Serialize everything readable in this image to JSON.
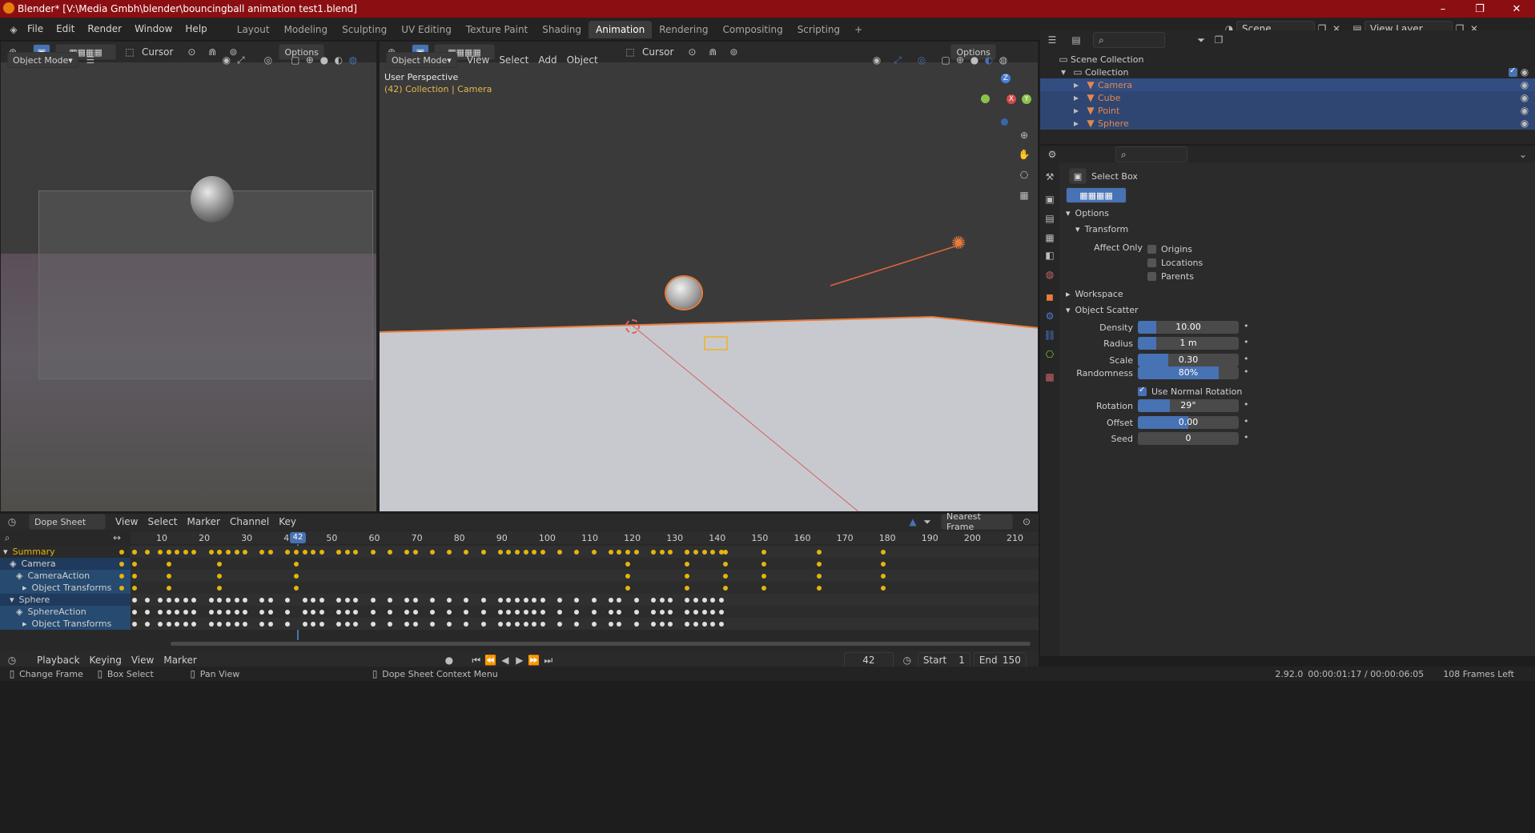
{
  "window": {
    "title": "Blender* [V:\\Media Gmbh\\blender\\bouncingball animation test1.blend]",
    "minimize": "–",
    "maximize": "❐",
    "close": "✕"
  },
  "menu": [
    "File",
    "Edit",
    "Render",
    "Window",
    "Help"
  ],
  "workspaces": [
    {
      "label": "Layout",
      "active": false
    },
    {
      "label": "Modeling",
      "active": false
    },
    {
      "label": "Sculpting",
      "active": false
    },
    {
      "label": "UV Editing",
      "active": false
    },
    {
      "label": "Texture Paint",
      "active": false
    },
    {
      "label": "Shading",
      "active": false
    },
    {
      "label": "Animation",
      "active": true
    },
    {
      "label": "Rendering",
      "active": false
    },
    {
      "label": "Compositing",
      "active": false
    },
    {
      "label": "Scripting",
      "active": false
    },
    {
      "label": "+",
      "active": false
    }
  ],
  "scene_field": "Scene",
  "viewlayer_field": "View Layer",
  "left_viewport": {
    "cursor_label": "Cursor",
    "options_label": "Options",
    "mode": "Object Mode"
  },
  "main_viewport": {
    "cursor_label": "Cursor",
    "options_label": "Options",
    "mode": "Object Mode",
    "menus": [
      "View",
      "Select",
      "Add",
      "Object"
    ],
    "overlay_title": "User Perspective",
    "overlay_sub": "(42) Collection | Camera",
    "gizmo_z": "Z",
    "gizmo_x": "X",
    "gizmo_y": "Y"
  },
  "outliner": {
    "scene_collection": "Scene Collection",
    "collection": "Collection",
    "items": [
      {
        "label": "Camera",
        "color": "#e3884e",
        "selected": true
      },
      {
        "label": "Cube",
        "color": "#e3884e",
        "selected": false
      },
      {
        "label": "Point",
        "color": "#e3884e",
        "selected": false
      },
      {
        "label": "Sphere",
        "color": "#e3884e",
        "selected": false
      }
    ]
  },
  "properties": {
    "tool_name": "Select Box",
    "options_header": "Options",
    "transform_header": "Transform",
    "affect_only": "Affect Only",
    "affect_items": [
      "Origins",
      "Locations",
      "Parents"
    ],
    "workspace_header": "Workspace",
    "scatter_header": "Object Scatter",
    "fields": [
      {
        "label": "Density",
        "value": "10.00",
        "fill": 0.18
      },
      {
        "label": "Radius",
        "value": "1 m",
        "fill": 0.18
      },
      {
        "label": "Scale",
        "value": "0.30",
        "fill": 0.3
      },
      {
        "label": "Randomness",
        "value": "80%",
        "fill": 0.8
      },
      {
        "label": "Rotation",
        "value": "29°",
        "fill": 0.32
      },
      {
        "label": "Offset",
        "value": "0.00",
        "fill": 0.5
      },
      {
        "label": "Seed",
        "value": "0",
        "fill": 0.0
      }
    ],
    "use_normal_rotation": "Use Normal Rotation"
  },
  "dopesheet": {
    "editor": "Dope Sheet",
    "menus": [
      "View",
      "Select",
      "Marker",
      "Channel",
      "Key"
    ],
    "snap": "Nearest Frame",
    "current_frame": "42",
    "ruler": [
      "10",
      "20",
      "30",
      "40",
      "50",
      "60",
      "70",
      "80",
      "90",
      "100",
      "110",
      "120",
      "130",
      "140",
      "150",
      "160",
      "170",
      "180",
      "190",
      "200",
      "210"
    ],
    "channels": [
      {
        "label": "Summary",
        "indent": 0
      },
      {
        "label": "Camera",
        "indent": 1
      },
      {
        "label": "CameraAction",
        "indent": 2
      },
      {
        "label": "Object Transforms",
        "indent": 3
      },
      {
        "label": "Sphere",
        "indent": 1
      },
      {
        "label": "SphereAction",
        "indent": 2
      },
      {
        "label": "Object Transforms",
        "indent": 3
      }
    ]
  },
  "timeline": {
    "menus": [
      "Playback",
      "Keying",
      "View",
      "Marker"
    ],
    "frame": "42",
    "start_label": "Start",
    "start": "1",
    "end_label": "End",
    "end": "150"
  },
  "status": {
    "change_frame": "Change Frame",
    "box_select": "Box Select",
    "pan_view": "Pan View",
    "context_menu": "Dope Sheet Context Menu",
    "version": "2.92.0",
    "time": "00:00:01:17 / 00:00:06:05",
    "frames_left": "108 Frames Left"
  }
}
